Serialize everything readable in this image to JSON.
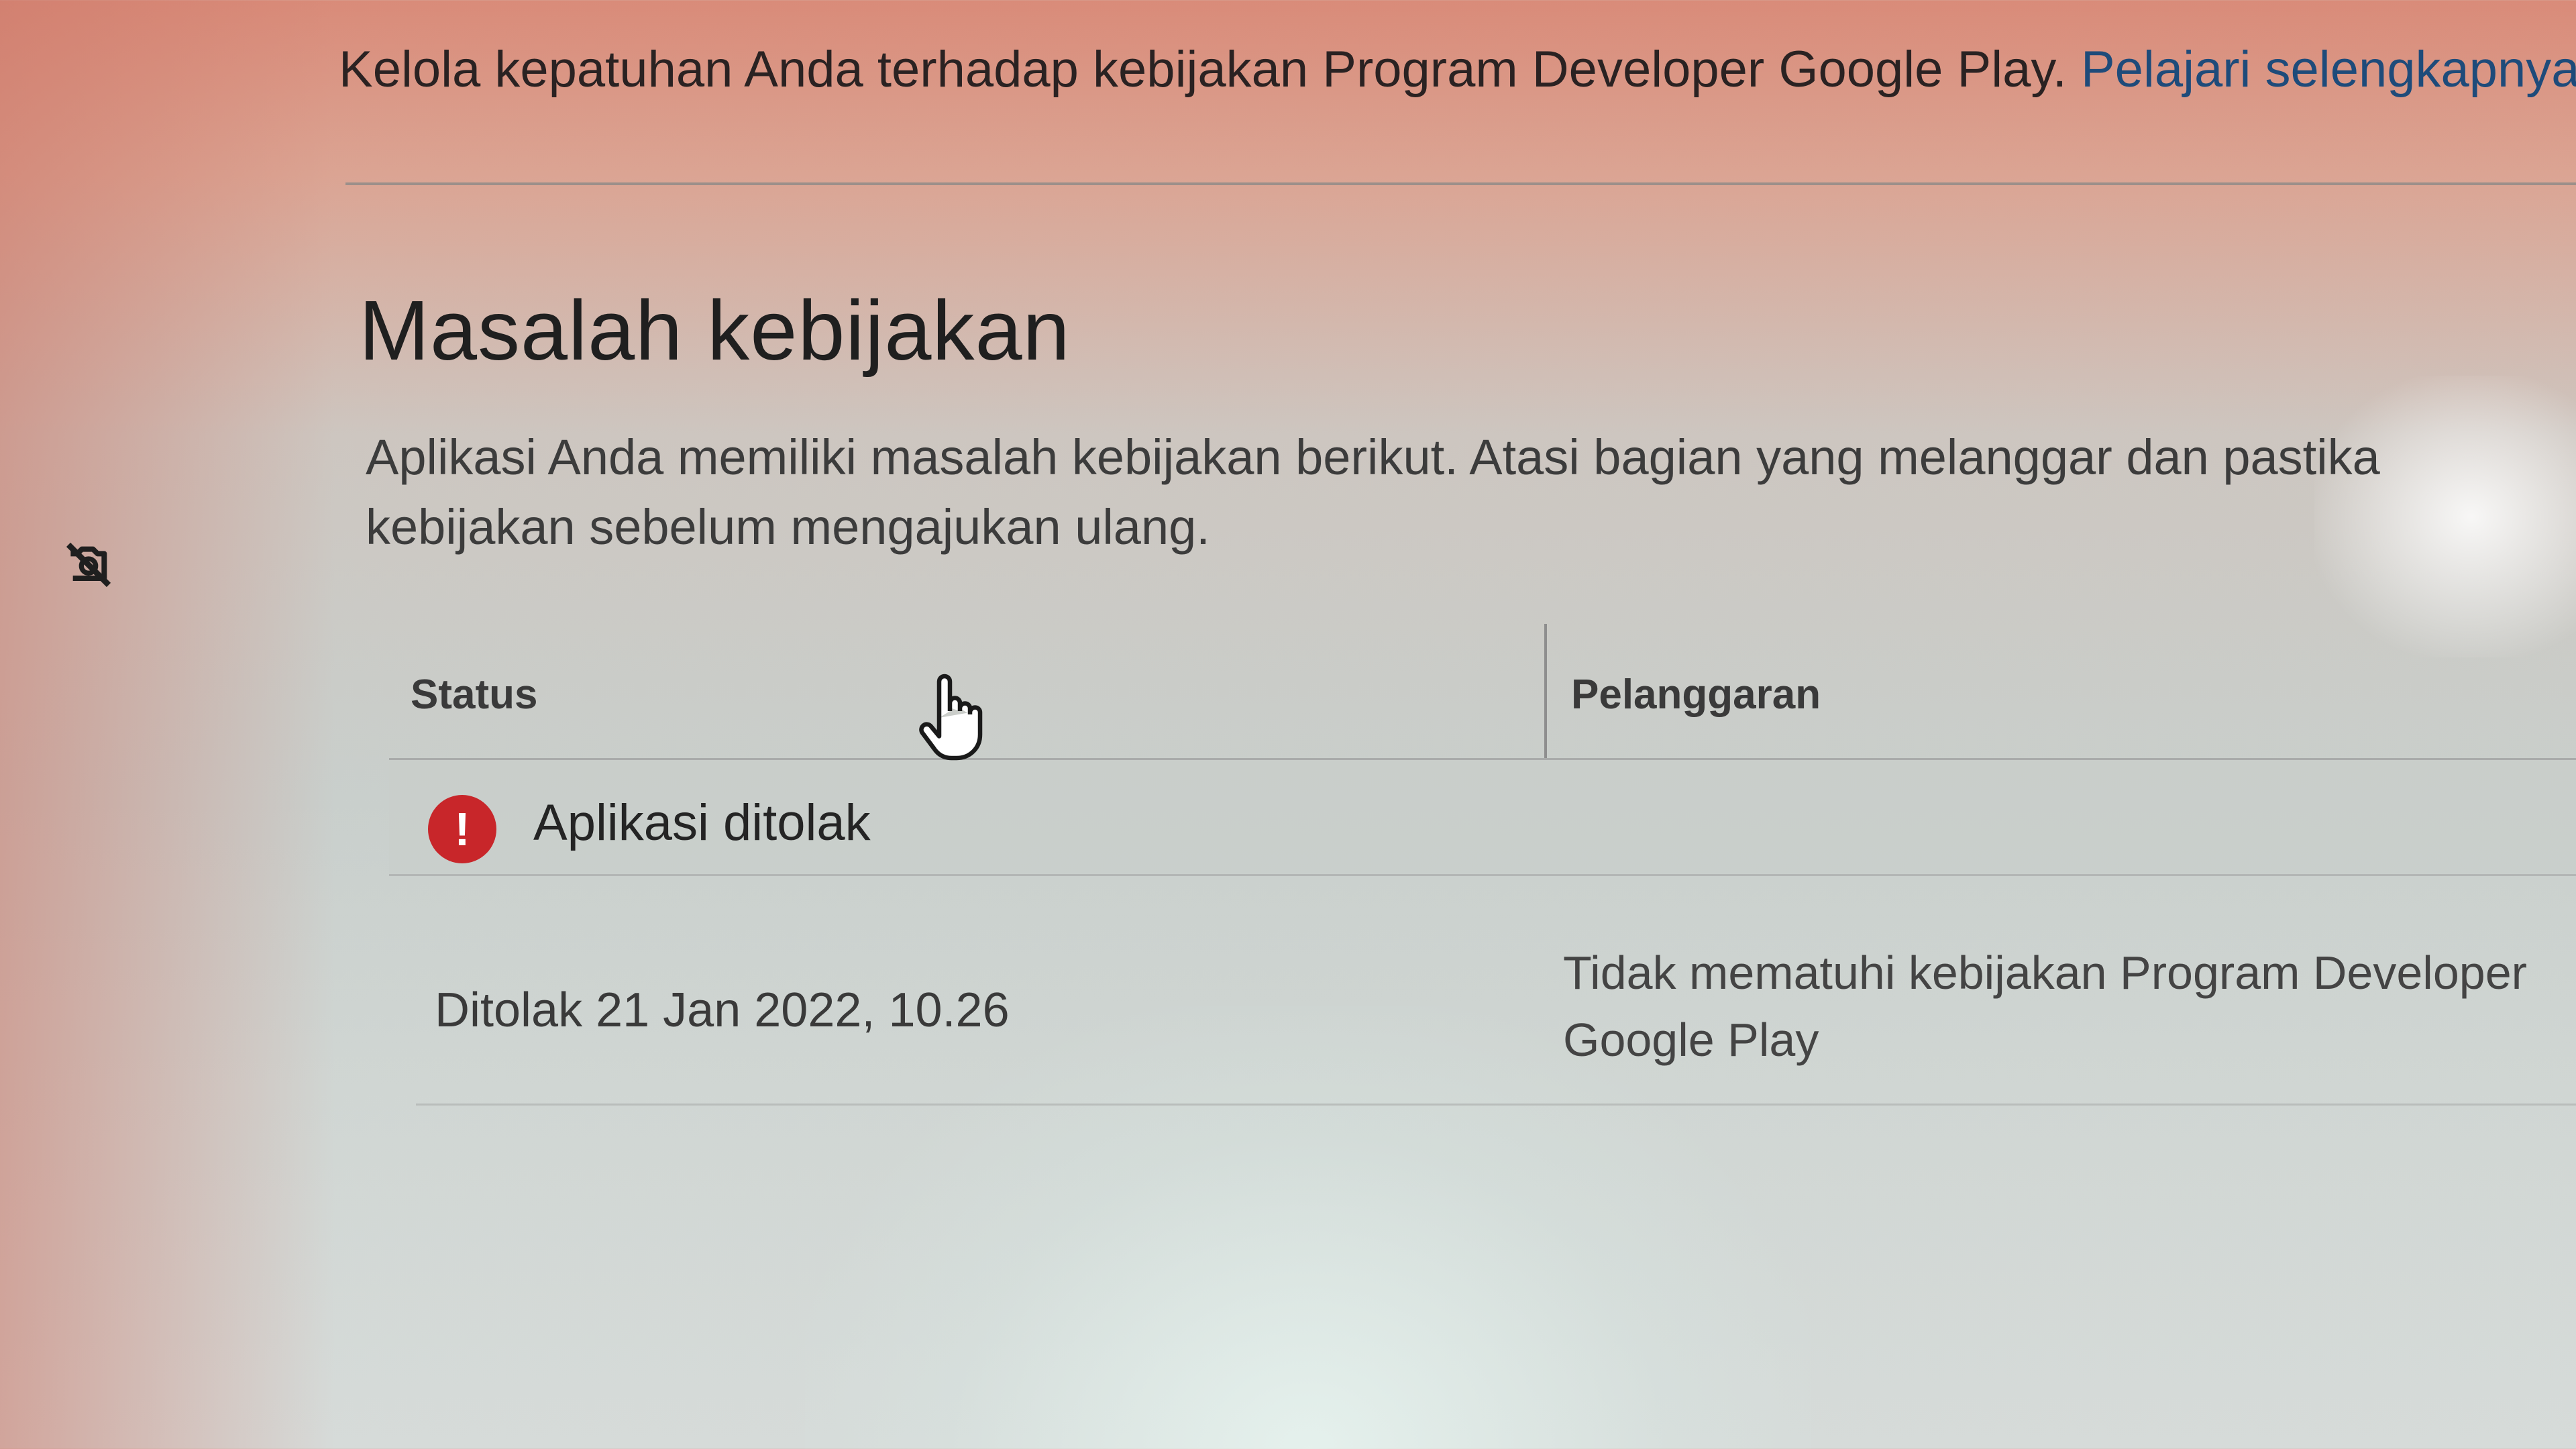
{
  "intro": {
    "text": "Kelola kepatuhan Anda terhadap kebijakan Program Developer Google Play.",
    "link": "Pelajari selengkapnya"
  },
  "section": {
    "title": "Masalah kebijakan",
    "description": "Aplikasi Anda memiliki masalah kebijakan berikut. Atasi bagian yang melanggar dan pastika kebijakan sebelum mengajukan ulang."
  },
  "table": {
    "headers": [
      "Status",
      "Pelanggaran"
    ],
    "status_label": "Aplikasi ditolak",
    "status_icon": "error-exclamation-icon",
    "row": {
      "date": "Ditolak 21 Jan 2022, 10.26",
      "violation": "Tidak mematuhi kebijakan Program Developer Google Play"
    }
  },
  "icons": {
    "side": "camera-off-icon",
    "cursor": "hand-pointer-icon"
  },
  "colors": {
    "error": "#c8262a",
    "link": "#1e4b7a"
  }
}
